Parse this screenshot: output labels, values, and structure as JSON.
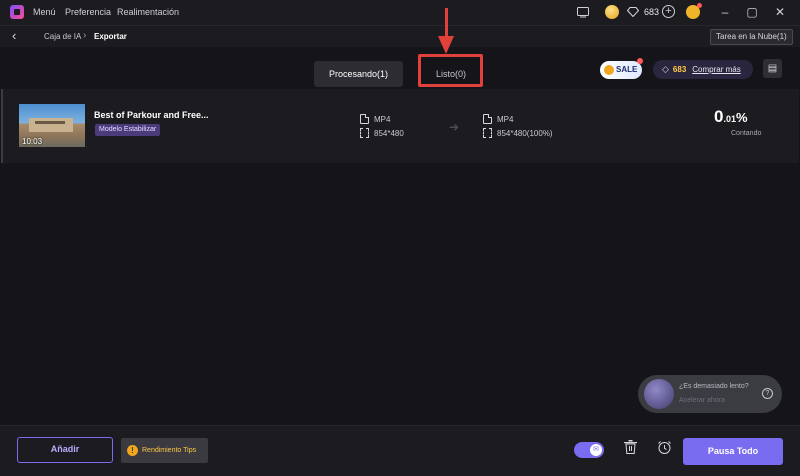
{
  "titlebar": {
    "menu": [
      "Menú",
      "Preferencia",
      "Realimentación"
    ],
    "gem_count": "683",
    "icons": [
      "app-logo",
      "screen-record-icon",
      "coin-icon",
      "gem-icon",
      "plus-icon",
      "user-avatar",
      "minimize-icon",
      "maximize-icon",
      "close-icon"
    ]
  },
  "breadcrumb": {
    "items": [
      "Caja de IA",
      "Exportar"
    ],
    "separator": "›",
    "cloud_task": "Tarea en la Nube(1)"
  },
  "tabs": [
    {
      "label": "Procesando(1)",
      "active": true
    },
    {
      "label": "Listo(0)",
      "active": false
    }
  ],
  "promo": {
    "sale_label": "SALE",
    "credits": "683",
    "buy_more": "Comprar más"
  },
  "task": {
    "thumbnail_duration": "10:03",
    "title": "Best of Parkour and Free...",
    "model_tag": "Modelo Estabilizar",
    "input": {
      "format": "MP4",
      "resolution": "854*480"
    },
    "output": {
      "format": "MP4",
      "resolution": "854*480(100%)"
    },
    "progress": {
      "main": "0",
      "decimal": ".01",
      "sign": "%",
      "value_percent": 0.01,
      "status": "Contando"
    }
  },
  "slow_tip": {
    "question": "¿Es demasiado lento?",
    "action": "Acelerar ahora",
    "help": "?"
  },
  "footer": {
    "add_label": "Añadir",
    "tips_label": "Rendimiento Tips",
    "tips_icon": "!",
    "pause_all_label": "Pausa Todo",
    "toggle_on": true
  },
  "colors": {
    "accent": "#7a6cf0",
    "highlight": "#e0413a",
    "gold": "#ffc845"
  }
}
